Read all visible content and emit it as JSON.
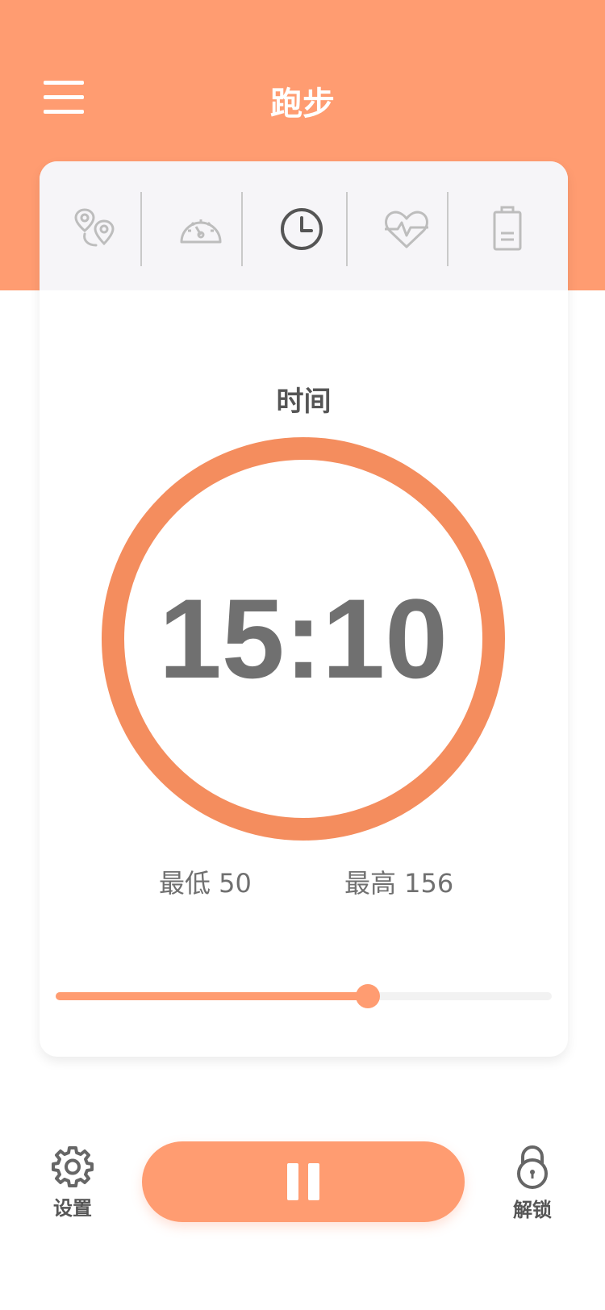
{
  "header": {
    "title": "跑步",
    "background": "#FF9C71",
    "menu_icon": "hamburger-menu-icon"
  },
  "tabs": [
    {
      "icon": "route-pins-icon",
      "selected": false
    },
    {
      "icon": "speedometer-icon",
      "selected": false
    },
    {
      "icon": "clock-icon",
      "selected": true
    },
    {
      "icon": "heart-rate-icon",
      "selected": false
    },
    {
      "icon": "battery-icon",
      "selected": false
    }
  ],
  "metric": {
    "label": "时间",
    "value": "15:10",
    "ring_color": "#F48D5E",
    "min_label": "最低 50",
    "max_label": "最高 156"
  },
  "slider": {
    "progress": 0.63,
    "fill_color": "#FF9C71"
  },
  "bottom_bar": {
    "settings_label": "设置",
    "settings_icon": "gear-icon",
    "pause_icon": "pause-icon",
    "unlock_label": "解锁",
    "unlock_icon": "padlock-icon"
  }
}
